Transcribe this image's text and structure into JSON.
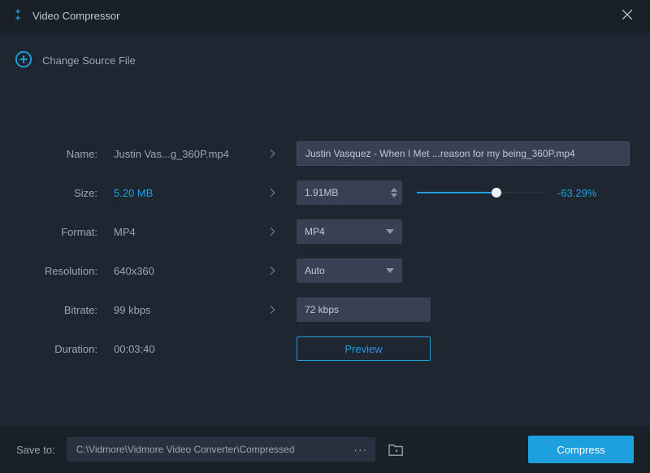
{
  "title": "Video Compressor",
  "change_source_label": "Change Source File",
  "labels": {
    "name": "Name:",
    "size": "Size:",
    "format": "Format:",
    "resolution": "Resolution:",
    "bitrate": "Bitrate:",
    "duration": "Duration:"
  },
  "source": {
    "name": "Justin Vas...g_360P.mp4",
    "size": "5.20 MB",
    "format": "MP4",
    "resolution": "640x360",
    "bitrate": "99 kbps",
    "duration": "00:03:40"
  },
  "target": {
    "name": "Justin Vasquez - When I Met ...reason for my being_360P.mp4",
    "size": "1.91MB",
    "format": "MP4",
    "resolution": "Auto",
    "bitrate": "72 kbps",
    "percent": "-63.29%"
  },
  "preview_label": "Preview",
  "save_to_label": "Save to:",
  "save_path": "C:\\Vidmore\\Vidmore Video Converter\\Compressed",
  "browse_dots": "···",
  "compress_label": "Compress",
  "colors": {
    "accent": "#1fa0de",
    "bg": "#1e2632",
    "panel": "#1a2028",
    "field": "#374153"
  }
}
